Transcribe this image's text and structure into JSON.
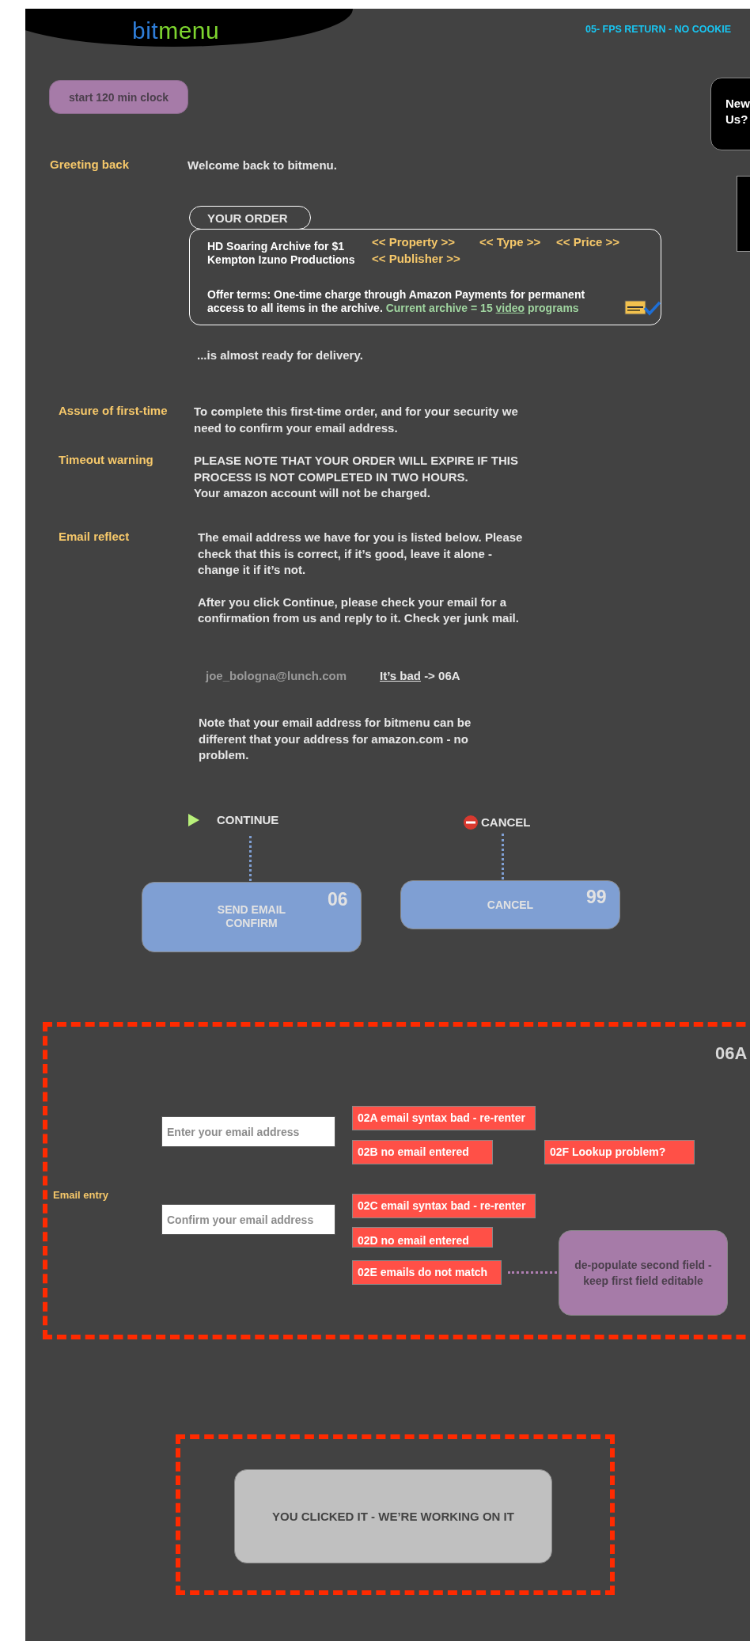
{
  "header": {
    "logo": [
      {
        "text": "bit",
        "color": "#2e7dd7"
      },
      {
        "text": "menu",
        "color": "#7ed52f"
      }
    ],
    "screen_id": "05- FPS RETURN - NO COOKIE"
  },
  "clock_button": "start 120 min clock",
  "side_card": {
    "text": "New Us?"
  },
  "greeting": {
    "label": "Greeting back",
    "text": "Welcome back to bitmenu."
  },
  "order": {
    "tab": "YOUR ORDER",
    "title": "HD Soaring Archive for $1",
    "publisher": "Kempton Izuno Productions",
    "placeholders": [
      "<< Property >>",
      "<< Type >>",
      "<< Price >>",
      "<< Publisher >>"
    ],
    "terms": "Offer terms: One-time charge through Amazon Payments for permanent access to all items in the archive.",
    "archive_before": "Current archive = 15",
    "archive_link": "video",
    "archive_after": "programs"
  },
  "ready": "...is almost ready for delivery.",
  "notes": [
    {
      "label": "Assure of first-time",
      "paragraphs": [
        "To complete this first-time order, and for your security we need to confirm your email address."
      ]
    },
    {
      "label": "Timeout warning",
      "paragraphs": [
        "PLEASE NOTE THAT YOUR ORDER WILL EXPIRE IF THIS PROCESS IS NOT COMPLETED IN TWO HOURS.",
        "Your amazon account will not be charged."
      ]
    },
    {
      "label": "Email reflect",
      "paragraphs": [
        "The email address we have for you is listed below. Please check that this is correct, if it’s good, leave it alone - change it if it’s not.",
        "After you click Continue, please check your email for a confirmation from us and reply to it. Check yer junk mail."
      ]
    }
  ],
  "email_reflect": {
    "email": "joe_bologna@lunch.com",
    "link": "It’s bad",
    "target": "-> 06A",
    "note": "Note that your email address for bitmenu can be different that your address for amazon.com - no problem."
  },
  "actions": [
    {
      "kind": "continue",
      "label": "CONTINUE",
      "box": "SEND EMAIL CONFIRM",
      "code": "06"
    },
    {
      "kind": "cancel",
      "label": "CANCEL",
      "box": "CANCEL",
      "code": "99"
    }
  ],
  "email_entry": {
    "id": "06A",
    "label": "Email entry",
    "fields": [
      {
        "placeholder": "Enter your email address"
      },
      {
        "placeholder": "Confirm your email address"
      }
    ],
    "errors": [
      "02A email syntax bad - re-renter",
      "02B no email entered",
      "02F Lookup problem?",
      "02C email syntax bad - re-renter",
      "02D no email entered",
      "02E emails do not match"
    ],
    "note": "de-populate second field - keep first field editable"
  },
  "working": "YOU CLICKED IT - WE’RE WORKING ON IT"
}
